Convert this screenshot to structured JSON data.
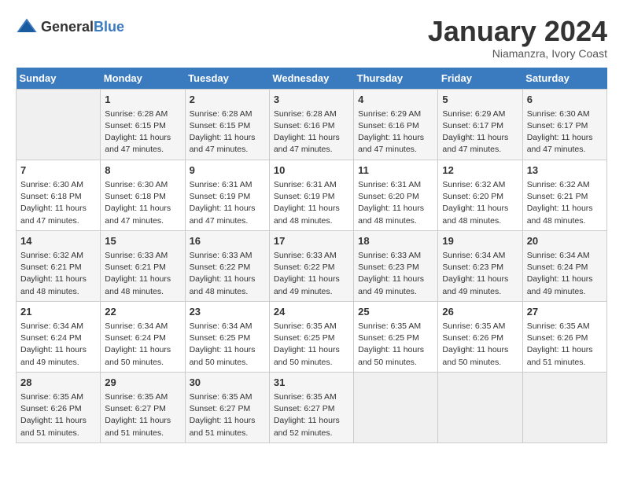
{
  "logo": {
    "general": "General",
    "blue": "Blue"
  },
  "header": {
    "month": "January 2024",
    "location": "Niamanzra, Ivory Coast"
  },
  "days_of_week": [
    "Sunday",
    "Monday",
    "Tuesday",
    "Wednesday",
    "Thursday",
    "Friday",
    "Saturday"
  ],
  "weeks": [
    [
      {
        "day": "",
        "info": ""
      },
      {
        "day": "1",
        "info": "Sunrise: 6:28 AM\nSunset: 6:15 PM\nDaylight: 11 hours and 47 minutes."
      },
      {
        "day": "2",
        "info": "Sunrise: 6:28 AM\nSunset: 6:15 PM\nDaylight: 11 hours and 47 minutes."
      },
      {
        "day": "3",
        "info": "Sunrise: 6:28 AM\nSunset: 6:16 PM\nDaylight: 11 hours and 47 minutes."
      },
      {
        "day": "4",
        "info": "Sunrise: 6:29 AM\nSunset: 6:16 PM\nDaylight: 11 hours and 47 minutes."
      },
      {
        "day": "5",
        "info": "Sunrise: 6:29 AM\nSunset: 6:17 PM\nDaylight: 11 hours and 47 minutes."
      },
      {
        "day": "6",
        "info": "Sunrise: 6:30 AM\nSunset: 6:17 PM\nDaylight: 11 hours and 47 minutes."
      }
    ],
    [
      {
        "day": "7",
        "info": "Sunrise: 6:30 AM\nSunset: 6:18 PM\nDaylight: 11 hours and 47 minutes."
      },
      {
        "day": "8",
        "info": "Sunrise: 6:30 AM\nSunset: 6:18 PM\nDaylight: 11 hours and 47 minutes."
      },
      {
        "day": "9",
        "info": "Sunrise: 6:31 AM\nSunset: 6:19 PM\nDaylight: 11 hours and 47 minutes."
      },
      {
        "day": "10",
        "info": "Sunrise: 6:31 AM\nSunset: 6:19 PM\nDaylight: 11 hours and 48 minutes."
      },
      {
        "day": "11",
        "info": "Sunrise: 6:31 AM\nSunset: 6:20 PM\nDaylight: 11 hours and 48 minutes."
      },
      {
        "day": "12",
        "info": "Sunrise: 6:32 AM\nSunset: 6:20 PM\nDaylight: 11 hours and 48 minutes."
      },
      {
        "day": "13",
        "info": "Sunrise: 6:32 AM\nSunset: 6:21 PM\nDaylight: 11 hours and 48 minutes."
      }
    ],
    [
      {
        "day": "14",
        "info": "Sunrise: 6:32 AM\nSunset: 6:21 PM\nDaylight: 11 hours and 48 minutes."
      },
      {
        "day": "15",
        "info": "Sunrise: 6:33 AM\nSunset: 6:21 PM\nDaylight: 11 hours and 48 minutes."
      },
      {
        "day": "16",
        "info": "Sunrise: 6:33 AM\nSunset: 6:22 PM\nDaylight: 11 hours and 48 minutes."
      },
      {
        "day": "17",
        "info": "Sunrise: 6:33 AM\nSunset: 6:22 PM\nDaylight: 11 hours and 49 minutes."
      },
      {
        "day": "18",
        "info": "Sunrise: 6:33 AM\nSunset: 6:23 PM\nDaylight: 11 hours and 49 minutes."
      },
      {
        "day": "19",
        "info": "Sunrise: 6:34 AM\nSunset: 6:23 PM\nDaylight: 11 hours and 49 minutes."
      },
      {
        "day": "20",
        "info": "Sunrise: 6:34 AM\nSunset: 6:24 PM\nDaylight: 11 hours and 49 minutes."
      }
    ],
    [
      {
        "day": "21",
        "info": "Sunrise: 6:34 AM\nSunset: 6:24 PM\nDaylight: 11 hours and 49 minutes."
      },
      {
        "day": "22",
        "info": "Sunrise: 6:34 AM\nSunset: 6:24 PM\nDaylight: 11 hours and 50 minutes."
      },
      {
        "day": "23",
        "info": "Sunrise: 6:34 AM\nSunset: 6:25 PM\nDaylight: 11 hours and 50 minutes."
      },
      {
        "day": "24",
        "info": "Sunrise: 6:35 AM\nSunset: 6:25 PM\nDaylight: 11 hours and 50 minutes."
      },
      {
        "day": "25",
        "info": "Sunrise: 6:35 AM\nSunset: 6:25 PM\nDaylight: 11 hours and 50 minutes."
      },
      {
        "day": "26",
        "info": "Sunrise: 6:35 AM\nSunset: 6:26 PM\nDaylight: 11 hours and 50 minutes."
      },
      {
        "day": "27",
        "info": "Sunrise: 6:35 AM\nSunset: 6:26 PM\nDaylight: 11 hours and 51 minutes."
      }
    ],
    [
      {
        "day": "28",
        "info": "Sunrise: 6:35 AM\nSunset: 6:26 PM\nDaylight: 11 hours and 51 minutes."
      },
      {
        "day": "29",
        "info": "Sunrise: 6:35 AM\nSunset: 6:27 PM\nDaylight: 11 hours and 51 minutes."
      },
      {
        "day": "30",
        "info": "Sunrise: 6:35 AM\nSunset: 6:27 PM\nDaylight: 11 hours and 51 minutes."
      },
      {
        "day": "31",
        "info": "Sunrise: 6:35 AM\nSunset: 6:27 PM\nDaylight: 11 hours and 52 minutes."
      },
      {
        "day": "",
        "info": ""
      },
      {
        "day": "",
        "info": ""
      },
      {
        "day": "",
        "info": ""
      }
    ]
  ]
}
